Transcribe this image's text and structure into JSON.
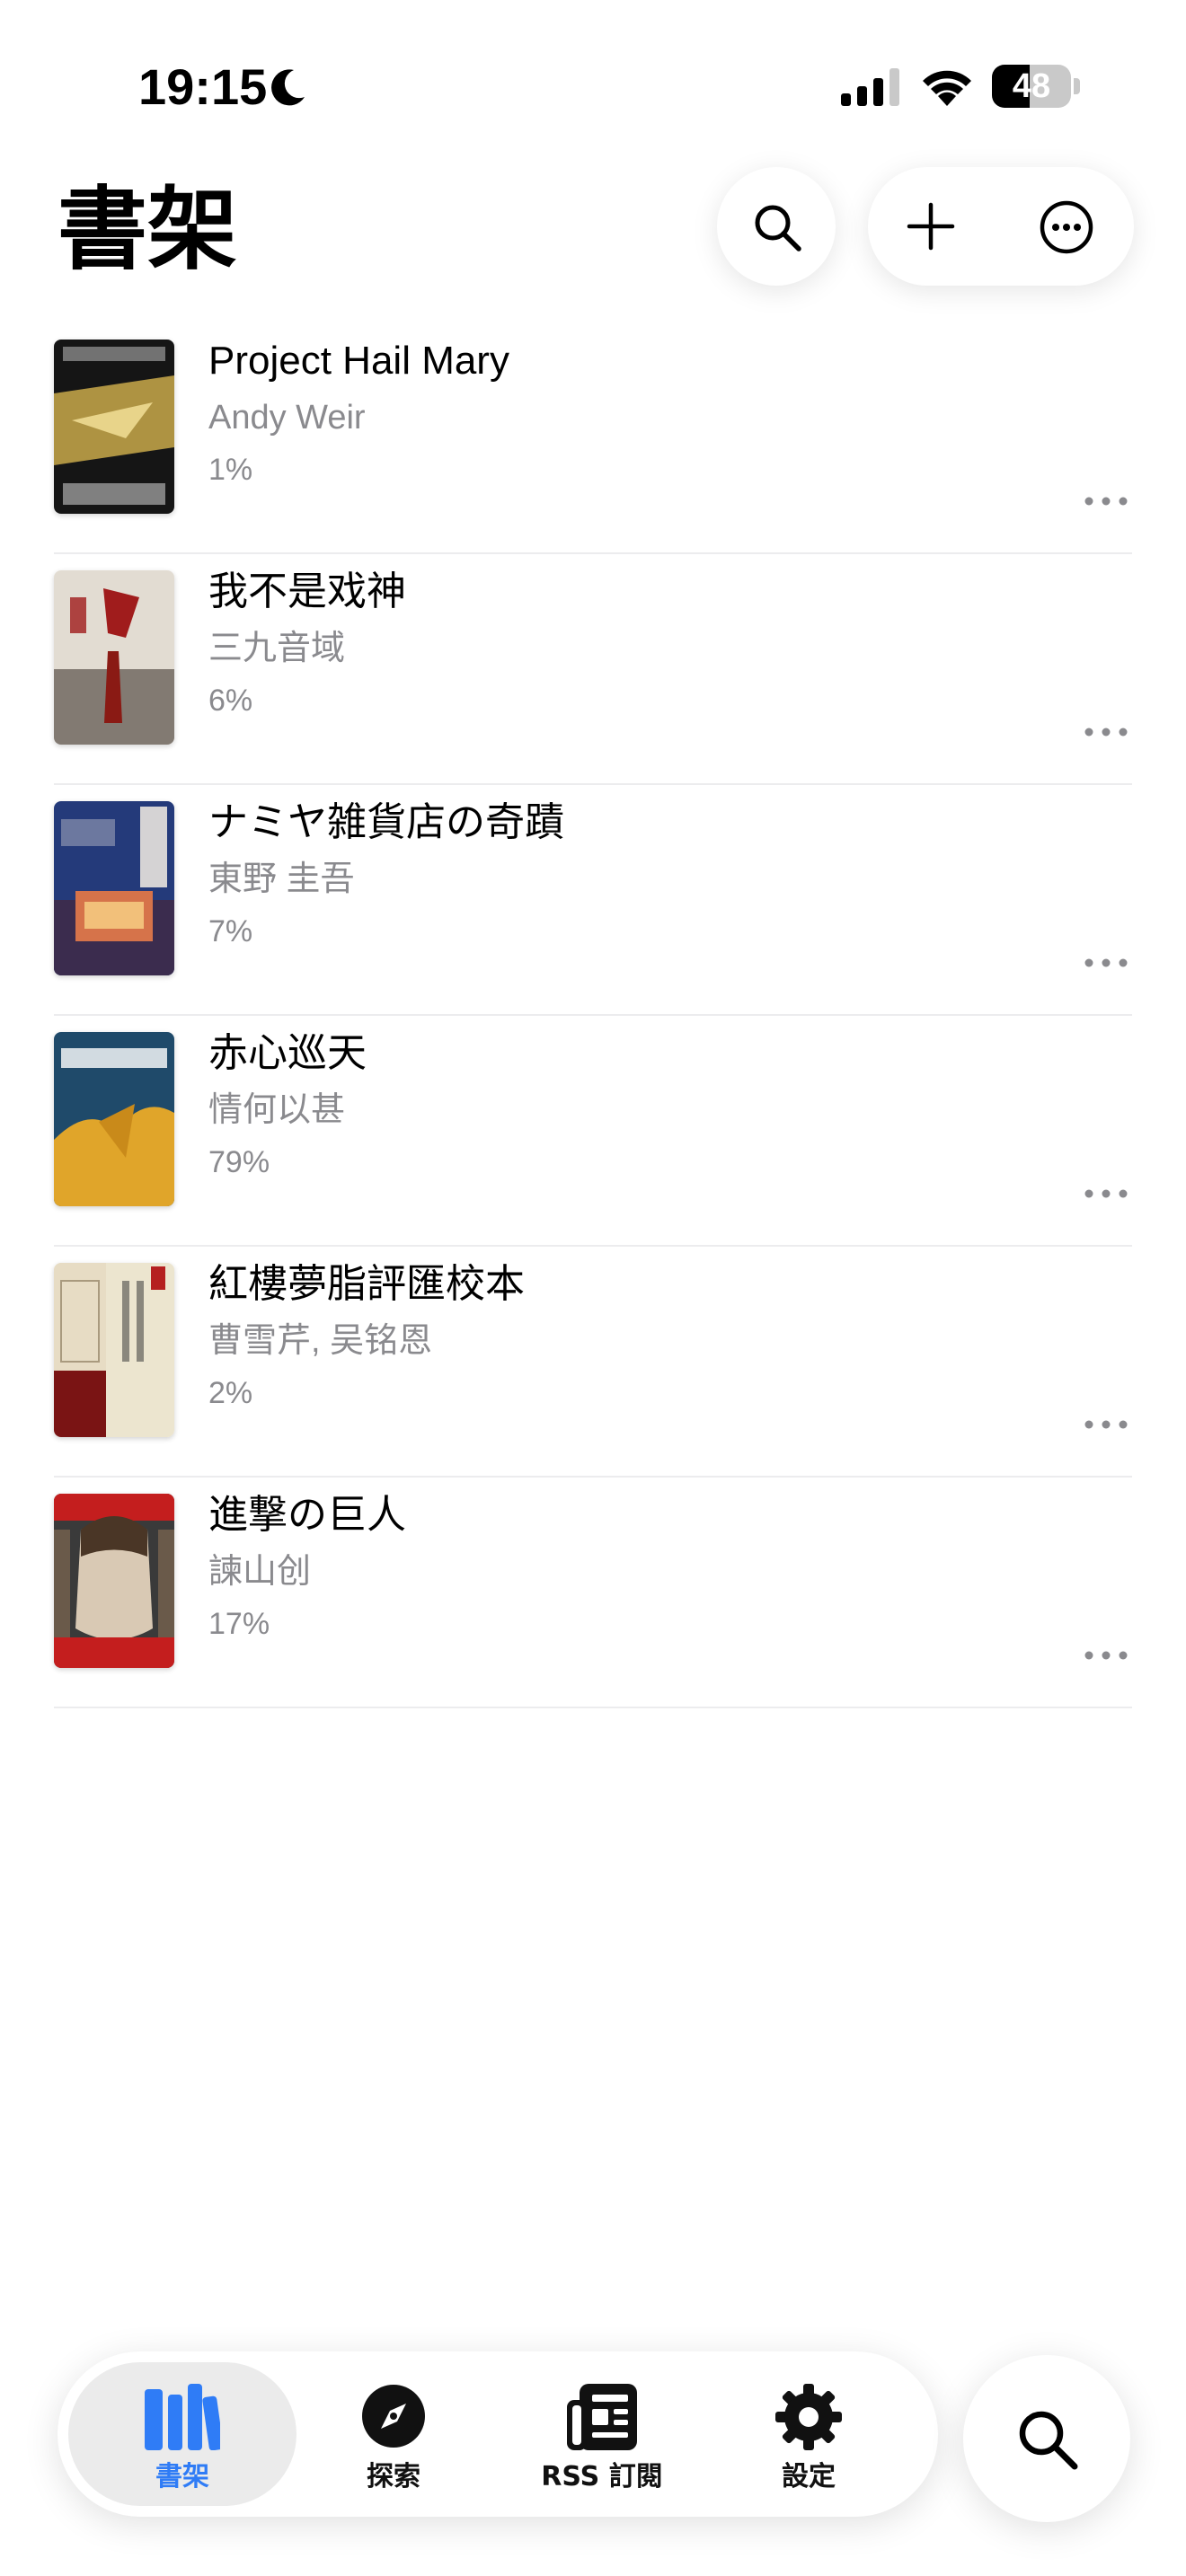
{
  "status_bar": {
    "time": "19:15",
    "battery_level": "48",
    "battery_fraction": 0.48,
    "icons": [
      "moon-icon",
      "signal-icon",
      "wifi-icon",
      "battery-icon"
    ]
  },
  "header": {
    "title": "書架",
    "buttons": [
      "search-icon",
      "plus-icon",
      "more-circle-icon"
    ]
  },
  "books": [
    {
      "title": "Project Hail Mary",
      "author": "Andy Weir",
      "progress": "1%",
      "cover_colors": [
        "#1c1c1c",
        "#c9a94a"
      ]
    },
    {
      "title": "我不是戏神",
      "author": "三九音域",
      "progress": "6%",
      "cover_colors": [
        "#e6e0d8",
        "#a01c1c"
      ]
    },
    {
      "title": "ナミヤ雑貨店の奇蹟",
      "author": "東野 圭吾",
      "progress": "7%",
      "cover_colors": [
        "#243a7a",
        "#d6734a"
      ]
    },
    {
      "title": "赤心巡天",
      "author": "情何以甚",
      "progress": "79%",
      "cover_colors": [
        "#1f4a6a",
        "#e0a52a"
      ]
    },
    {
      "title": "紅樓夢脂評匯校本",
      "author": "曹雪芹, 吴铭恩",
      "progress": "2%",
      "cover_colors": [
        "#ece5cf",
        "#7a1414"
      ]
    },
    {
      "title": "進撃の巨人",
      "author": "諫山创",
      "progress": "17%",
      "cover_colors": [
        "#3a3a3a",
        "#c41e1e"
      ]
    }
  ],
  "tab_bar": {
    "tabs": [
      {
        "label": "書架",
        "icon": "books-icon",
        "active": true
      },
      {
        "label": "探索",
        "icon": "compass-icon",
        "active": false
      },
      {
        "label": "RSS 訂閱",
        "icon": "newspaper-icon",
        "active": false
      },
      {
        "label": "設定",
        "icon": "gear-icon",
        "active": false
      }
    ],
    "search_icon": "search-icon"
  },
  "colors": {
    "accent": "#2f7cf6",
    "secondary_text": "#8a8a8e",
    "divider": "#ececee"
  }
}
